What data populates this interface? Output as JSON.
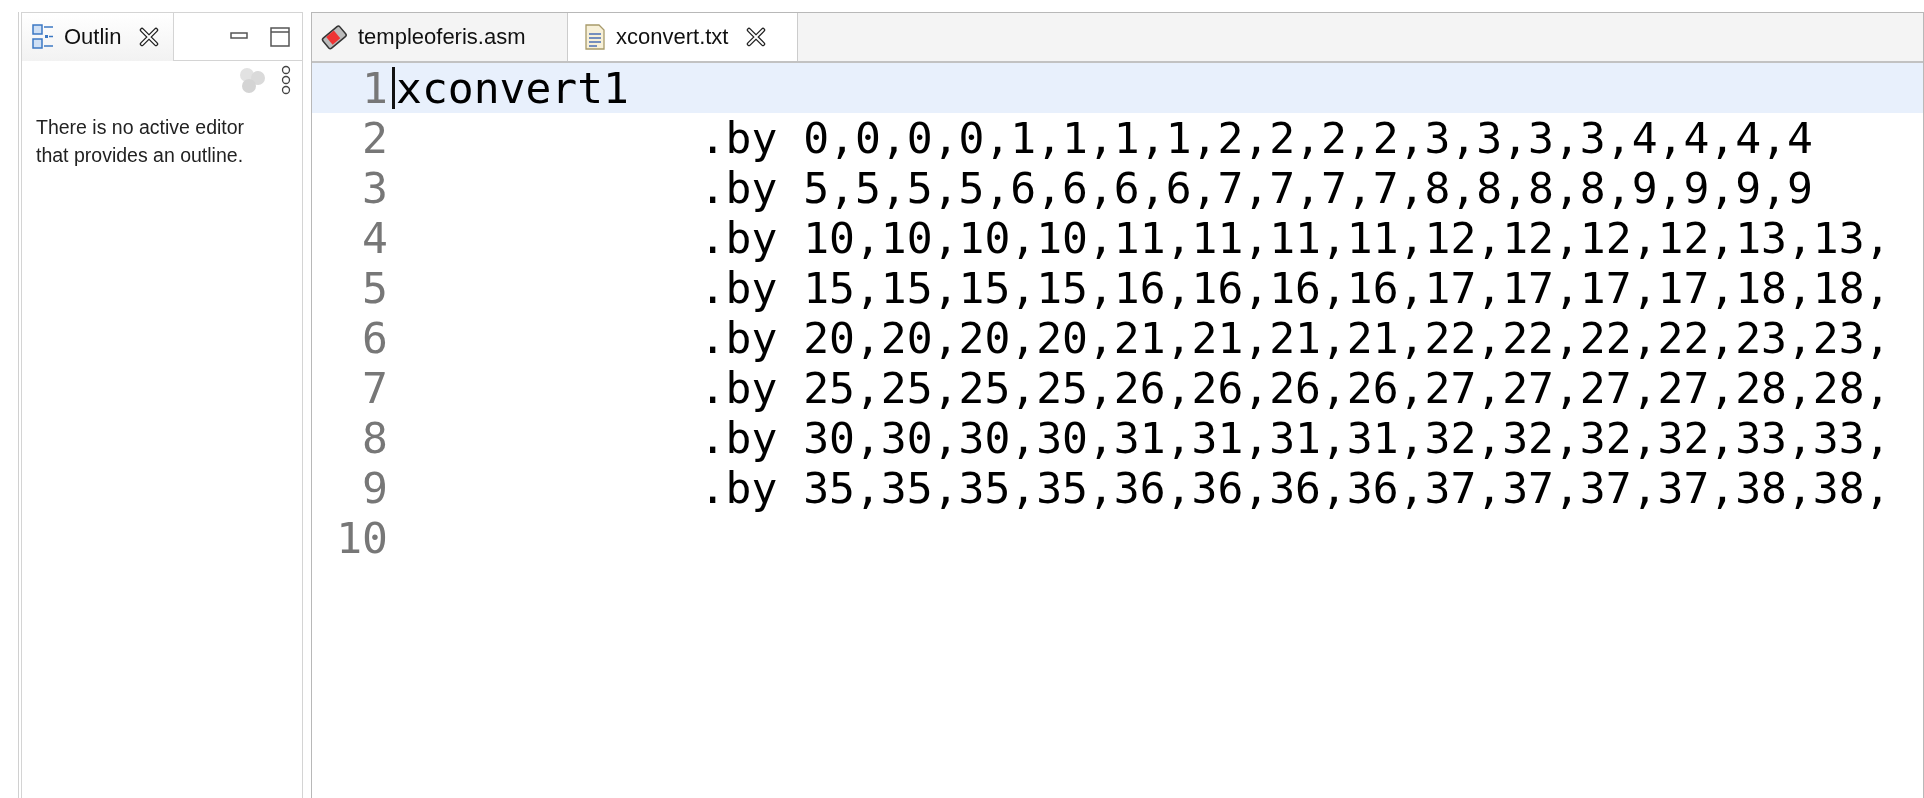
{
  "outline_panel": {
    "tab": {
      "label": "Outlin",
      "selected": true
    },
    "message": "There is no active editor that provides an outline."
  },
  "editor": {
    "tabs": [
      {
        "label": "templeoferis.asm",
        "kind": "asm",
        "selected": false
      },
      {
        "label": "xconvert.txt",
        "kind": "text",
        "selected": true
      }
    ],
    "lines": [
      {
        "number": "1",
        "text": "xconvert1",
        "kind": "label",
        "current": true
      },
      {
        "number": "2",
        "text": ".by 0,0,0,0,1,1,1,1,2,2,2,2,3,3,3,3,4,4,4,4",
        "kind": "data",
        "current": false
      },
      {
        "number": "3",
        "text": ".by 5,5,5,5,6,6,6,6,7,7,7,7,8,8,8,8,9,9,9,9",
        "kind": "data",
        "current": false
      },
      {
        "number": "4",
        "text": ".by 10,10,10,10,11,11,11,11,12,12,12,12,13,13,",
        "kind": "data",
        "current": false
      },
      {
        "number": "5",
        "text": ".by 15,15,15,15,16,16,16,16,17,17,17,17,18,18,",
        "kind": "data",
        "current": false
      },
      {
        "number": "6",
        "text": ".by 20,20,20,20,21,21,21,21,22,22,22,22,23,23,",
        "kind": "data",
        "current": false
      },
      {
        "number": "7",
        "text": ".by 25,25,25,25,26,26,26,26,27,27,27,27,28,28,",
        "kind": "data",
        "current": false
      },
      {
        "number": "8",
        "text": ".by 30,30,30,30,31,31,31,31,32,32,32,32,33,33,",
        "kind": "data",
        "current": false
      },
      {
        "number": "9",
        "text": ".by 35,35,35,35,36,36,36,36,37,37,37,37,38,38,",
        "kind": "data",
        "current": false
      },
      {
        "number": "10",
        "current": false
      }
    ]
  }
}
